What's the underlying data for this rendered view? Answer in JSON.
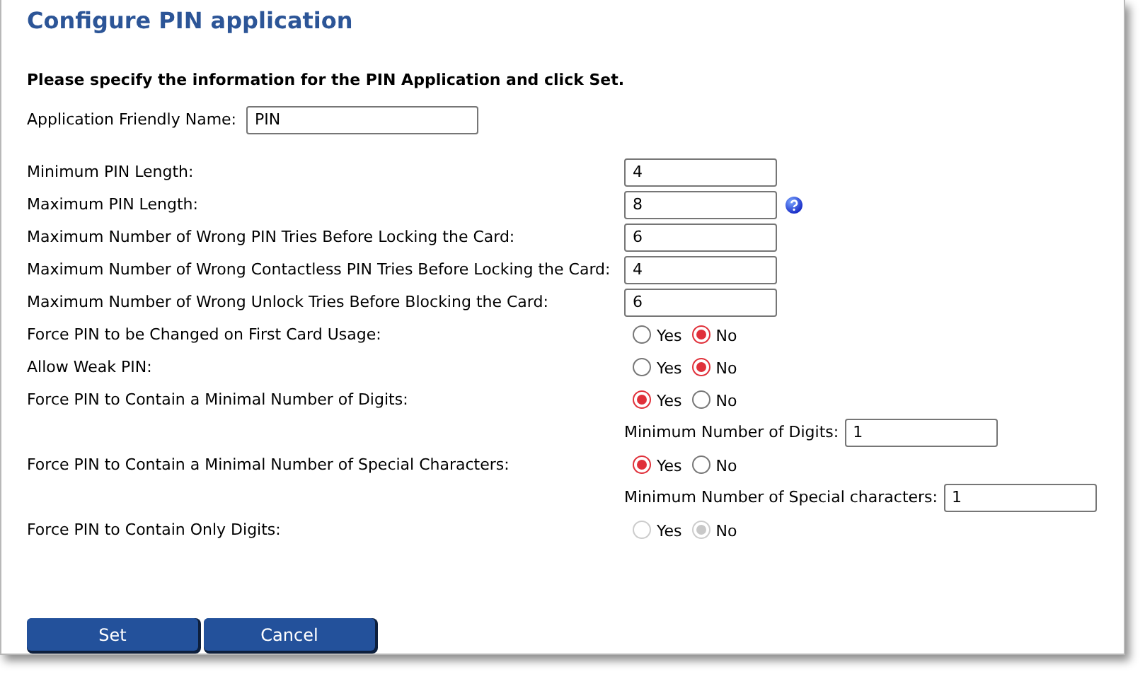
{
  "title": "Configure PIN application",
  "instruction": "Please specify the information for the PIN Application and click Set.",
  "friendly_name": {
    "label": "Application Friendly Name:",
    "value": "PIN"
  },
  "fields": [
    {
      "kind": "text",
      "label": "Minimum PIN Length:",
      "value": "4",
      "help": false
    },
    {
      "kind": "text",
      "label": "Maximum PIN Length:",
      "value": "8",
      "help": true
    },
    {
      "kind": "text",
      "label": "Maximum Number of Wrong PIN Tries Before Locking the Card:",
      "value": "6",
      "help": false
    },
    {
      "kind": "text",
      "label": "Maximum Number of Wrong Contactless PIN Tries Before Locking the Card:",
      "value": "4",
      "help": false
    },
    {
      "kind": "text",
      "label": "Maximum Number of Wrong Unlock Tries Before Blocking the Card:",
      "value": "6",
      "help": false
    },
    {
      "kind": "radio",
      "label": "Force PIN to be Changed on First Card Usage:",
      "disabled": false,
      "options": [
        {
          "label": "Yes",
          "selected": false
        },
        {
          "label": "No",
          "selected": true
        }
      ]
    },
    {
      "kind": "radio",
      "label": "Allow Weak PIN:",
      "disabled": false,
      "options": [
        {
          "label": "Yes",
          "selected": false
        },
        {
          "label": "No",
          "selected": true
        }
      ]
    },
    {
      "kind": "radio",
      "label": "Force PIN to Contain a Minimal Number of Digits:",
      "disabled": false,
      "options": [
        {
          "label": "Yes",
          "selected": true
        },
        {
          "label": "No",
          "selected": false
        }
      ]
    },
    {
      "kind": "subtext",
      "label": "Minimum Number of Digits:",
      "value": "1"
    },
    {
      "kind": "radio",
      "label": "Force PIN to Contain a Minimal Number of Special Characters:",
      "disabled": false,
      "options": [
        {
          "label": "Yes",
          "selected": true
        },
        {
          "label": "No",
          "selected": false
        }
      ]
    },
    {
      "kind": "subtext",
      "label": "Minimum Number of Special characters:",
      "value": "1"
    },
    {
      "kind": "radio",
      "label": "Force PIN to Contain Only Digits:",
      "disabled": true,
      "options": [
        {
          "label": "Yes",
          "selected": false
        },
        {
          "label": "No",
          "selected": true
        }
      ]
    }
  ],
  "buttons": [
    "Set",
    "Cancel"
  ]
}
